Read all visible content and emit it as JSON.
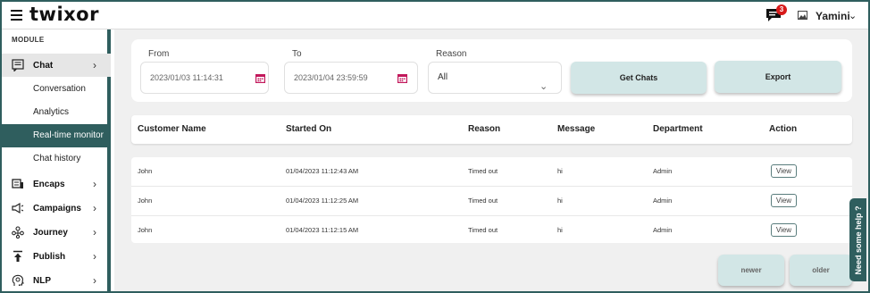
{
  "header": {
    "logo": "twixor",
    "notification_count": "3",
    "user_name": "Yamini"
  },
  "sidebar": {
    "module_label": "MODULE",
    "chat": {
      "label": "Chat",
      "children": [
        "Conversation",
        "Analytics",
        "Real-time monitor",
        "Chat history"
      ]
    },
    "items": [
      {
        "label": "Encaps"
      },
      {
        "label": "Campaigns"
      },
      {
        "label": "Journey"
      },
      {
        "label": "Publish"
      },
      {
        "label": "NLP"
      }
    ]
  },
  "filters": {
    "from_label": "From",
    "from_value": "2023/01/03 11:14:31",
    "to_label": "To",
    "to_value": "2023/01/04 23:59:59",
    "reason_label": "Reason",
    "reason_value": "All",
    "get_chats": "Get Chats",
    "export": "Export"
  },
  "table": {
    "columns": [
      "Customer Name",
      "Started On",
      "Reason",
      "Message",
      "Department",
      "Action"
    ],
    "rows": [
      {
        "customer": "John",
        "started": "01/04/2023 11:12:43 AM",
        "reason": "Timed out",
        "message": "hi",
        "department": "Admin",
        "action": "View"
      },
      {
        "customer": "John",
        "started": "01/04/2023 11:12:25 AM",
        "reason": "Timed out",
        "message": "hi",
        "department": "Admin",
        "action": "View"
      },
      {
        "customer": "John",
        "started": "01/04/2023 11:12:15 AM",
        "reason": "Timed out",
        "message": "hi",
        "department": "Admin",
        "action": "View"
      }
    ]
  },
  "pagination": {
    "newer": "newer",
    "older": "older"
  },
  "help_tab": "Need some help ?",
  "colors": {
    "accent": "#2f5e5e",
    "button_bg": "#d2e6e6",
    "badge": "#d81b1b",
    "calendar_icon": "#c2185b"
  },
  "icons": {
    "menu": "hamburger-icon",
    "chat_bubble": "chat-bubble-icon",
    "user_image": "image-icon",
    "calendar": "calendar-icon"
  }
}
